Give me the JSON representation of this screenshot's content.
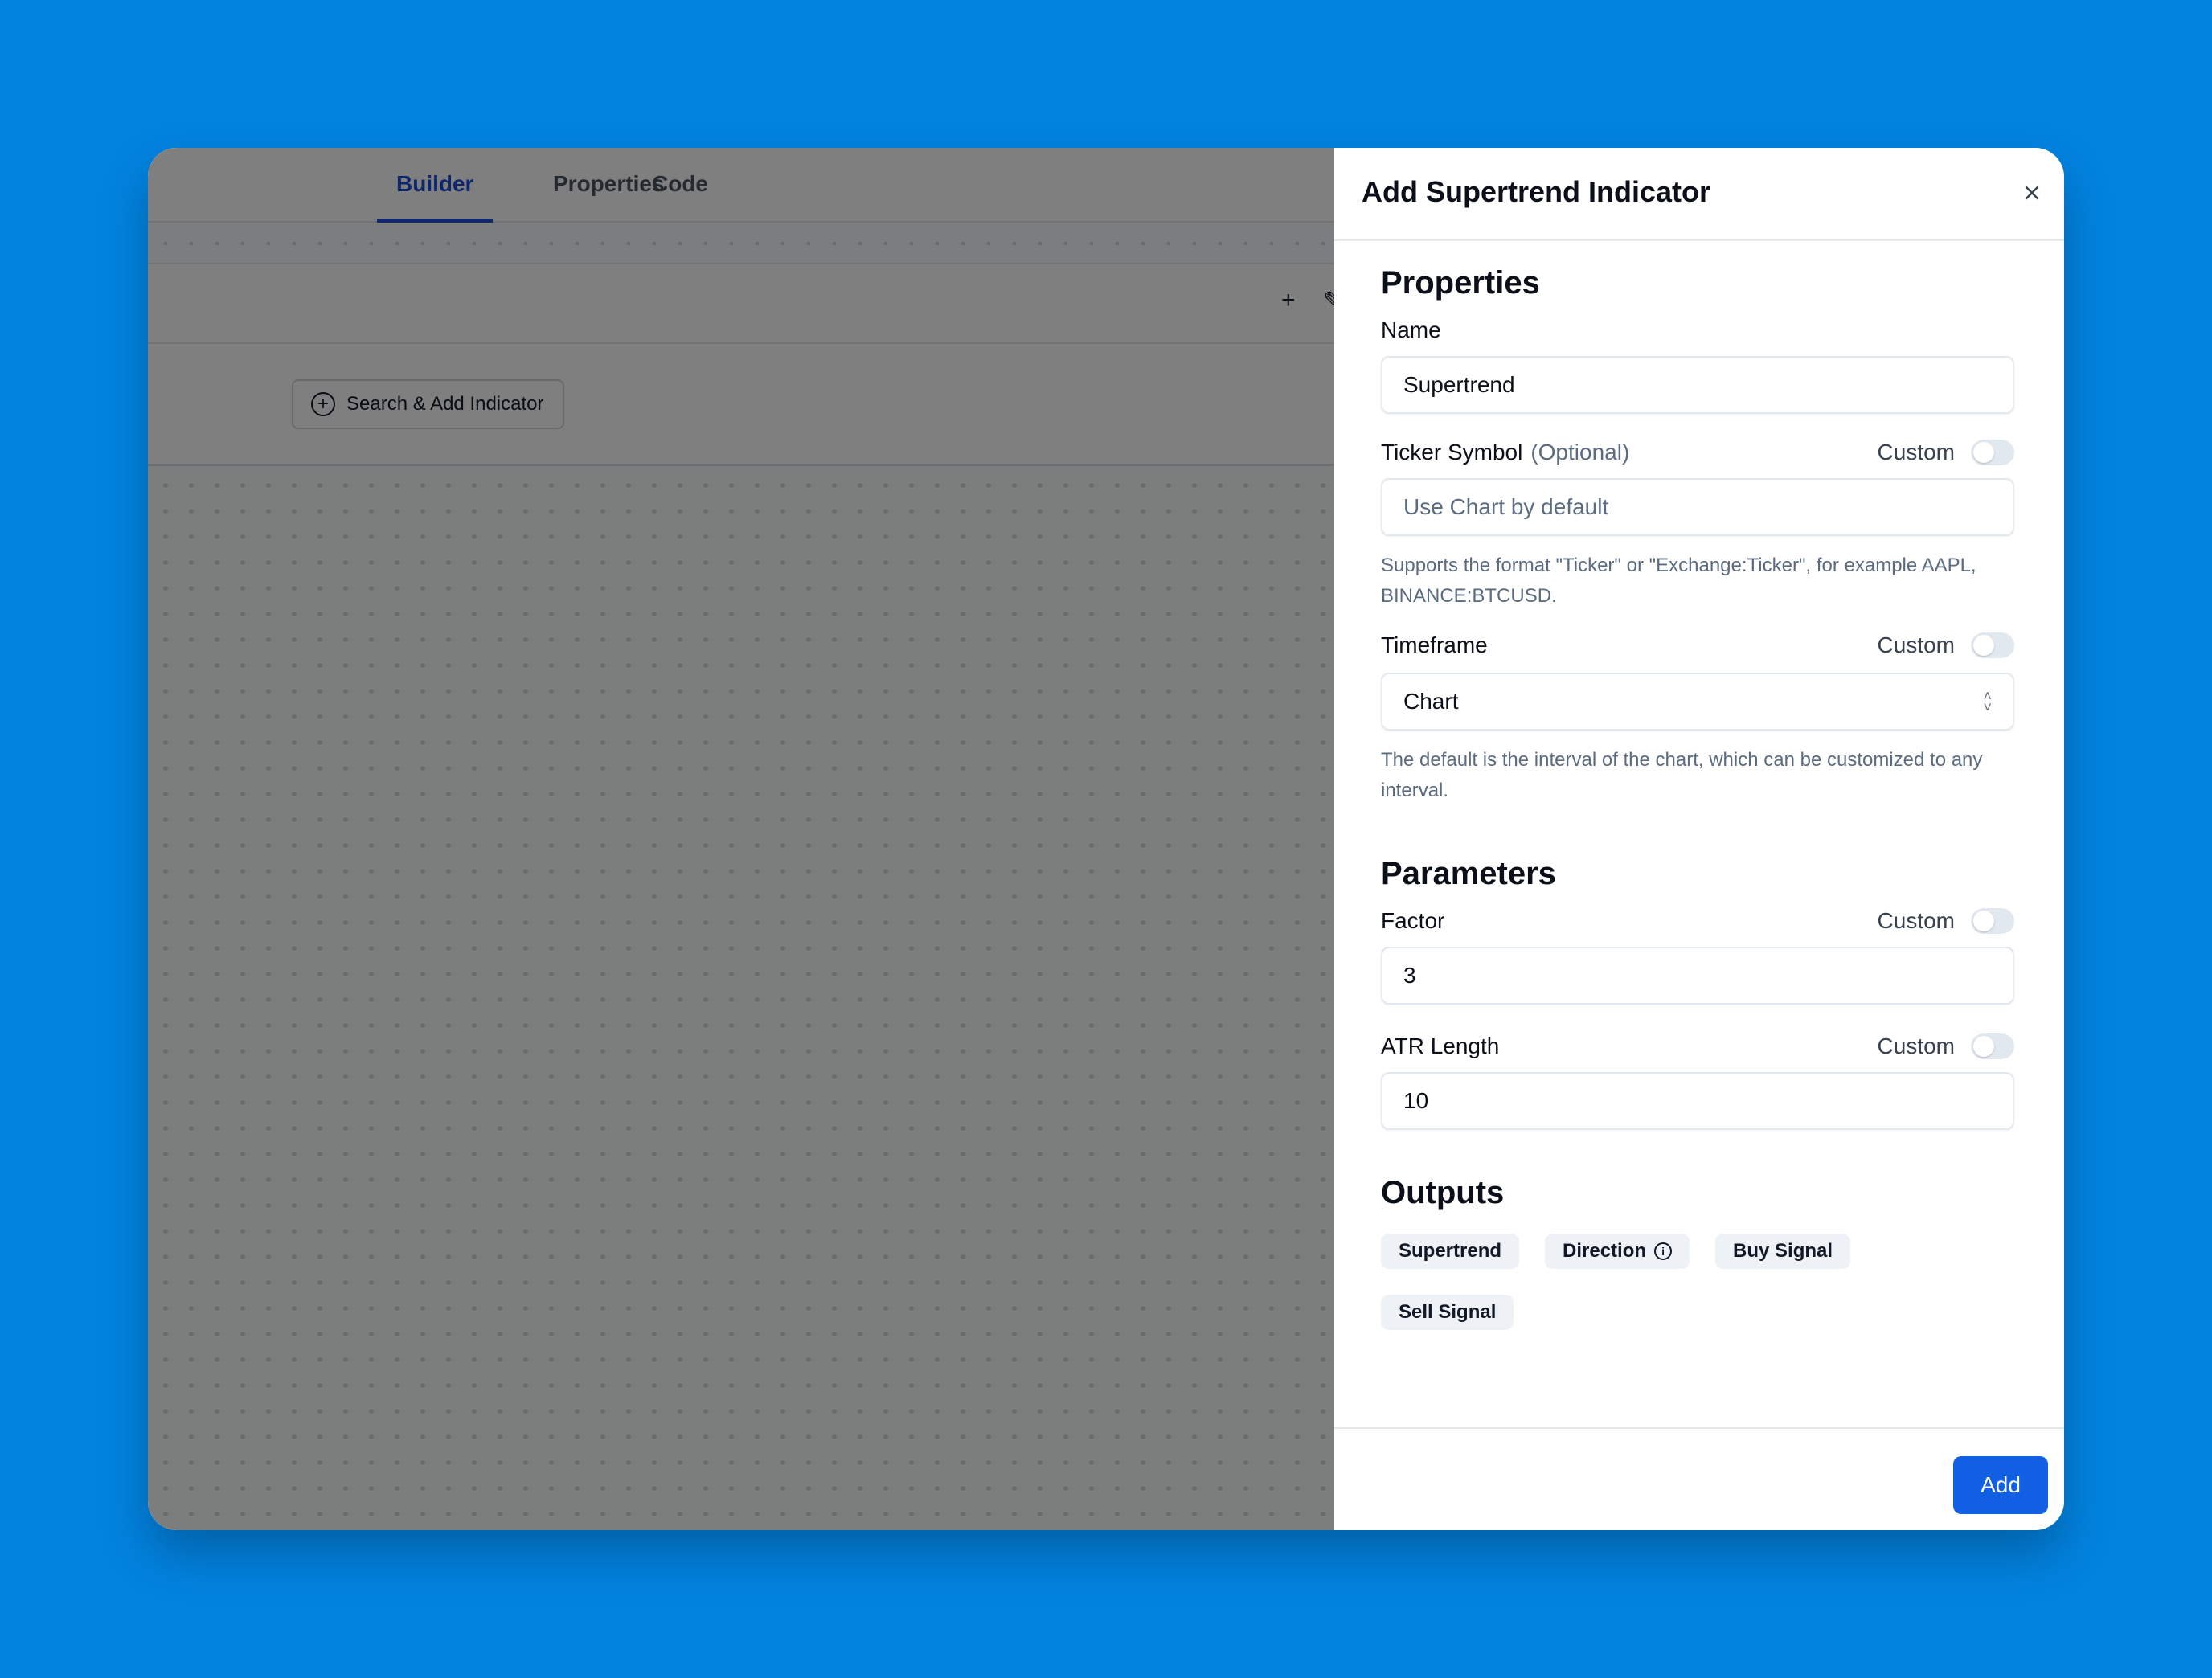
{
  "app": {
    "tabs": [
      {
        "label": "Builder",
        "active": true
      },
      {
        "label": "Properties",
        "active": false
      },
      {
        "label": "Code",
        "active": false
      }
    ],
    "toolbar": {
      "add_icon": "+",
      "edit_icon": "✎"
    },
    "search_add_button": "Search & Add Indicator"
  },
  "panel": {
    "title": "Add Supertrend Indicator",
    "close_icon": "×",
    "properties": {
      "heading": "Properties",
      "name": {
        "label": "Name",
        "value": "Supertrend"
      },
      "ticker": {
        "label": "Ticker Symbol",
        "optional": "(Optional)",
        "custom_label": "Custom",
        "custom_enabled": false,
        "placeholder": "Use Chart by default",
        "value": "",
        "hint": "Supports the format \"Ticker\" or \"Exchange:Ticker\", for example AAPL, BINANCE:BTCUSD."
      },
      "timeframe": {
        "label": "Timeframe",
        "custom_label": "Custom",
        "custom_enabled": false,
        "selected": "Chart",
        "hint": "The default is the interval of the chart, which can be customized to any interval."
      }
    },
    "parameters": {
      "heading": "Parameters",
      "factor": {
        "label": "Factor",
        "custom_label": "Custom",
        "custom_enabled": false,
        "value": "3"
      },
      "atr_length": {
        "label": "ATR Length",
        "custom_label": "Custom",
        "custom_enabled": false,
        "value": "10"
      }
    },
    "outputs": {
      "heading": "Outputs",
      "items": [
        {
          "label": "Supertrend",
          "info": false
        },
        {
          "label": "Direction",
          "info": true
        },
        {
          "label": "Buy Signal",
          "info": false
        },
        {
          "label": "Sell Signal",
          "info": false
        }
      ]
    },
    "footer": {
      "add_label": "Add"
    }
  },
  "colors": {
    "background": "#0283e0",
    "accent": "#1160e3",
    "active_tab": "#1d4ed8"
  }
}
